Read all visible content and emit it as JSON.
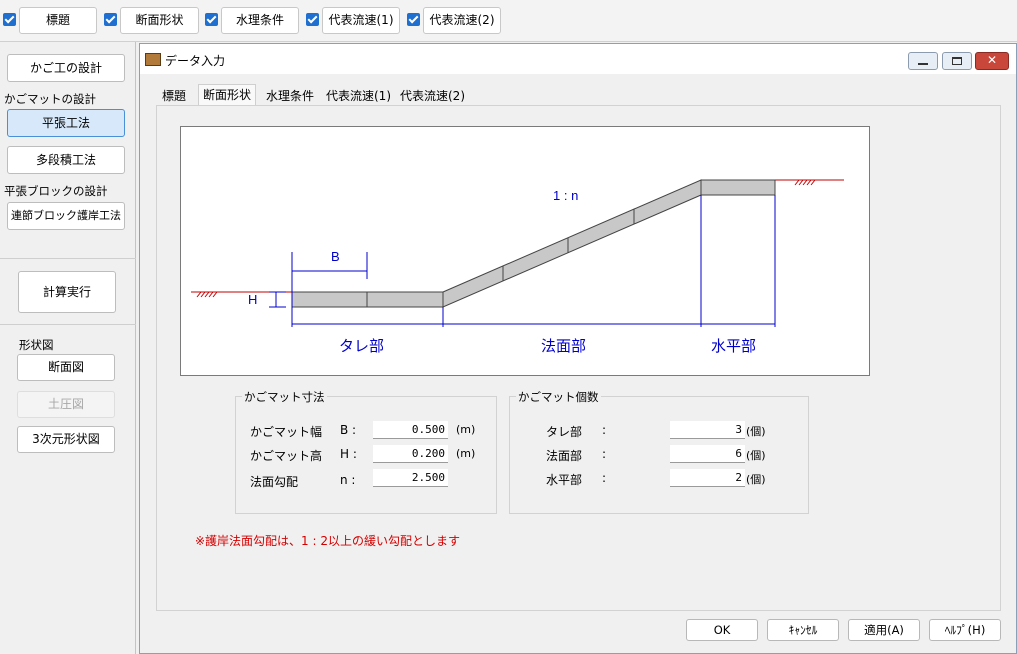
{
  "toolbar": {
    "tabs": [
      {
        "label": "標題",
        "checked": true
      },
      {
        "label": "断面形状",
        "checked": true
      },
      {
        "label": "水理条件",
        "checked": true
      },
      {
        "label": "代表流速(1)",
        "checked": true
      },
      {
        "label": "代表流速(2)",
        "checked": true
      }
    ]
  },
  "sidebar": {
    "btn_kago": "かご工の設計",
    "section_kagomat": "かごマットの設計",
    "btn_heichou": "平張工法",
    "btn_tadanzumi": "多段積工法",
    "section_block": "平張ブロックの設計",
    "btn_renketsu": "連節ブロック護岸工法",
    "btn_calc": "計算実行",
    "section_shape": "形状図",
    "btn_danmen": "断面図",
    "btn_doatsu": "土圧図",
    "btn_3d": "3次元形状図"
  },
  "dialog": {
    "title": "データ入力",
    "tabs": [
      "標題",
      "断面形状",
      "水理条件",
      "代表流速(1)",
      "代表流速(2)"
    ],
    "active_tab": 1,
    "diagram": {
      "label_B": "B",
      "label_H": "H",
      "label_slope": "1 : n",
      "label_tare": "タレ部",
      "label_homen": "法面部",
      "label_suihei": "水平部"
    },
    "dims": {
      "title": "かごマット寸法",
      "rows": [
        {
          "label": "かごマット幅",
          "sym": "B :",
          "value": "0.500",
          "unit": "(m)"
        },
        {
          "label": "かごマット高",
          "sym": "H :",
          "value": "0.200",
          "unit": "(m)"
        },
        {
          "label": "法面勾配",
          "sym": "n :",
          "value": "2.500",
          "unit": ""
        }
      ]
    },
    "counts": {
      "title": "かごマット個数",
      "rows": [
        {
          "label": "タレ部",
          "sym": ":",
          "value": "3",
          "unit": "(個)"
        },
        {
          "label": "法面部",
          "sym": ":",
          "value": "6",
          "unit": "(個)"
        },
        {
          "label": "水平部",
          "sym": ":",
          "value": "2",
          "unit": "(個)"
        }
      ]
    },
    "note": "※護岸法面勾配は、1 : 2以上の緩い勾配とします",
    "buttons": {
      "ok": "OK",
      "cancel": "ｷｬﾝｾﾙ",
      "apply": "適用(A)",
      "help": "ﾍﾙﾌﾟ(H)"
    }
  },
  "colors": {
    "accent": "#1f6fd1",
    "dimension": "#0000cc",
    "note": "#d40000"
  }
}
